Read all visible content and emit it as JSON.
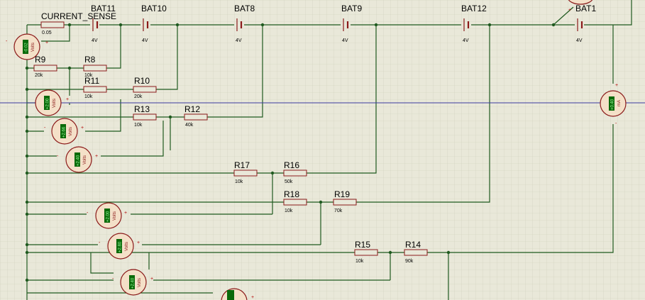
{
  "colors": {
    "background": "#e9e8d9",
    "grid": "#c9c8b3",
    "wire": "#1f5a1f",
    "probe_line": "#3a3aa0",
    "component": "#8b1a1a",
    "meter_fill": "#f4e0c8",
    "meter_display": "#0a6a0a",
    "meter_text": "#9fff9f"
  },
  "sense": {
    "name": "CURRENT_SENSE",
    "value": "0.05"
  },
  "batteries": [
    {
      "name": "BAT11",
      "value": "4V"
    },
    {
      "name": "BAT10",
      "value": "4V"
    },
    {
      "name": "BAT8",
      "value": "4V"
    },
    {
      "name": "BAT9",
      "value": "4V"
    },
    {
      "name": "BAT12",
      "value": "4V"
    },
    {
      "name": "BAT1",
      "value": "4V"
    }
  ],
  "resistors": [
    {
      "name": "R9",
      "value": "20k"
    },
    {
      "name": "R8",
      "value": "10k"
    },
    {
      "name": "R11",
      "value": "10k"
    },
    {
      "name": "R10",
      "value": "20k"
    },
    {
      "name": "R13",
      "value": "10k"
    },
    {
      "name": "R12",
      "value": "40k"
    },
    {
      "name": "R17",
      "value": "10k"
    },
    {
      "name": "R16",
      "value": "50k"
    },
    {
      "name": "R18",
      "value": "10k"
    },
    {
      "name": "R19",
      "value": "70k"
    },
    {
      "name": "R15",
      "value": "10k"
    },
    {
      "name": "R14",
      "value": "90k"
    }
  ],
  "meters": [
    {
      "unit": "Volts",
      "reading": "-0.02"
    },
    {
      "unit": "Volts",
      "reading": "+2.00"
    },
    {
      "unit": "Volts",
      "reading": "+2.66"
    },
    {
      "unit": "Volts",
      "reading": "+2.40"
    },
    {
      "unit": "Volts",
      "reading": "+2.00"
    },
    {
      "unit": "Volts",
      "reading": "+2.80"
    },
    {
      "unit": "Volts",
      "reading": "+2.40"
    },
    {
      "unit": "mA",
      "reading": "+0.40"
    }
  ]
}
